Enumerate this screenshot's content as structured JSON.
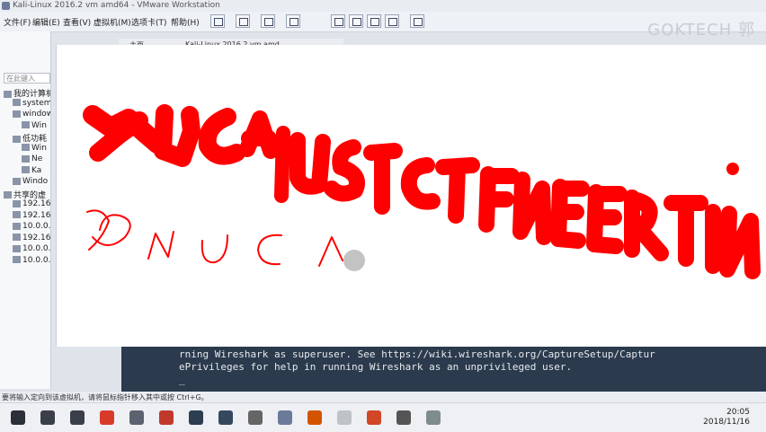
{
  "window": {
    "title": "Kali-Linux 2016.2 vm amd64 - VMware Workstation"
  },
  "menus": [
    "文件(F)",
    "编辑(E)",
    "查看(V)",
    "虚拟机(M)",
    "选项卡(T)",
    "帮助(H)"
  ],
  "brand": "GOKTECH 郭",
  "sidebar": {
    "search_placeholder": "在此键入",
    "items": [
      {
        "label": "我的计算机",
        "icon": "computer-icon"
      },
      {
        "label": "system",
        "icon": "vm-icon"
      },
      {
        "label": "windows",
        "icon": "folder-icon"
      },
      {
        "label": "Win",
        "icon": "vm-icon"
      },
      {
        "label": "低功耗",
        "icon": "folder-icon"
      },
      {
        "label": "Win",
        "icon": "vm-icon"
      },
      {
        "label": "Ne",
        "icon": "vm-icon"
      },
      {
        "label": "Ka",
        "icon": "vm-icon"
      },
      {
        "label": "Windo",
        "icon": "vm-icon"
      },
      {
        "label": "共享的虚",
        "icon": "folder-icon"
      },
      {
        "label": "192.168.",
        "icon": "host-icon"
      },
      {
        "label": "192.168.",
        "icon": "host-icon"
      },
      {
        "label": "10.0.0.20",
        "icon": "host-icon"
      },
      {
        "label": "192.168.",
        "icon": "host-icon"
      },
      {
        "label": "10.0.0.22",
        "icon": "host-icon"
      },
      {
        "label": "10.0.0.20",
        "icon": "host-icon"
      }
    ]
  },
  "tabs": [
    {
      "label": "主页"
    },
    {
      "label": "Kali-Linux 2016.2 vm amd"
    }
  ],
  "canvas": {
    "handwriting_bold": "XNUCA UESTCTFNEERTIN",
    "handwriting_thin": "XNUCA"
  },
  "terminal": {
    "lines": [
      "rning Wireshark as superuser. See https://wiki.wireshark.org/CaptureSetup/Captur",
      "ePrivileges for help in running Wireshark as an unprivileged user.",
      "_"
    ]
  },
  "statusbar": {
    "text": "要将输入定向到该虚拟机，请将鼠标指针移入其中或按 Ctrl+G。"
  },
  "taskbar": {
    "clock_time": "20:05",
    "clock_date": "2018/11/16",
    "icons": [
      {
        "name": "windows-start-icon",
        "color": "#2b2f38"
      },
      {
        "name": "search-icon",
        "color": "#3a3f4a"
      },
      {
        "name": "taskview-icon",
        "color": "#3a3f4a"
      },
      {
        "name": "browser-icon",
        "color": "#d83a2a"
      },
      {
        "name": "app-icon",
        "color": "#5d6270"
      },
      {
        "name": "app-icon",
        "color": "#c0392b"
      },
      {
        "name": "app-icon",
        "color": "#2c3e50"
      },
      {
        "name": "app-icon",
        "color": "#34495e"
      },
      {
        "name": "app-icon",
        "color": "#666"
      },
      {
        "name": "vmware-icon",
        "color": "#6b7a99"
      },
      {
        "name": "app-icon",
        "color": "#d35400"
      },
      {
        "name": "app-icon",
        "color": "#bdc3c7"
      },
      {
        "name": "powerpoint-icon",
        "color": "#d24726"
      },
      {
        "name": "settings-icon",
        "color": "#555"
      },
      {
        "name": "app-icon",
        "color": "#7f8c8d"
      }
    ]
  },
  "colors": {
    "accent": "#ff0000",
    "terminal_bg": "#2b3a4d"
  }
}
